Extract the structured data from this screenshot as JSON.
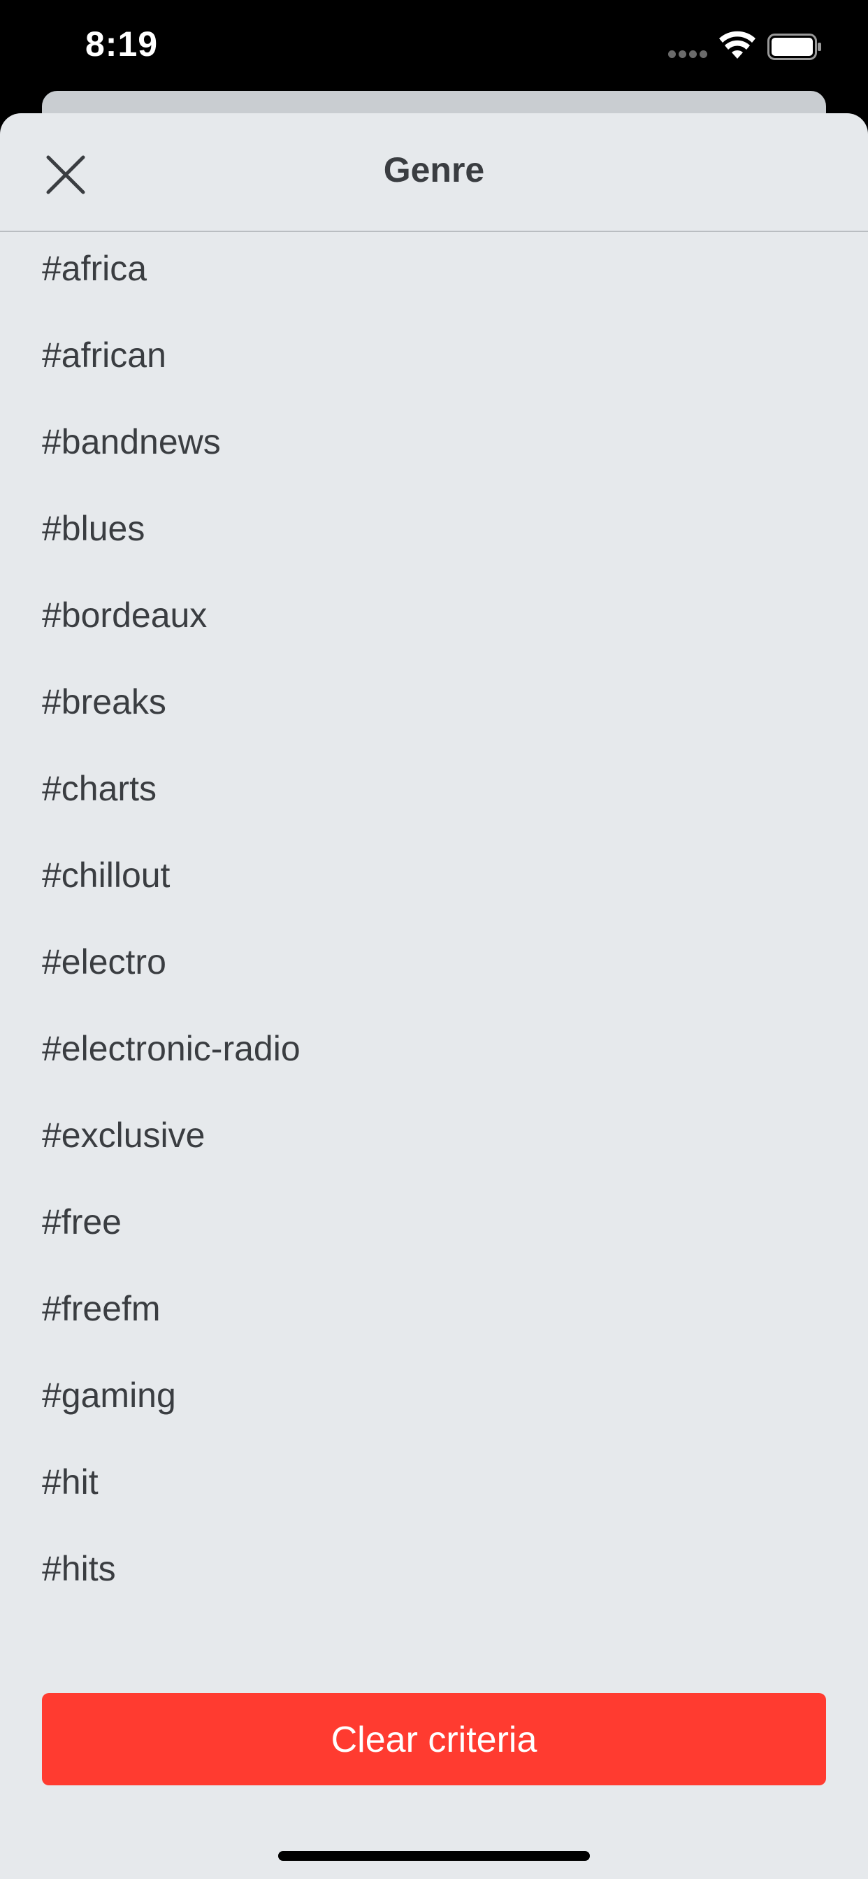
{
  "status_bar": {
    "time": "8:19",
    "icons": [
      "signal-dots-icon",
      "wifi-icon",
      "battery-icon"
    ]
  },
  "sheet": {
    "title": "Genre",
    "close_icon": "close-icon"
  },
  "genres": [
    "#africa",
    "#african",
    "#bandnews",
    "#blues",
    "#bordeaux",
    "#breaks",
    "#charts",
    "#chillout",
    "#electro",
    "#electronic-radio",
    "#exclusive",
    "#free",
    "#freefm",
    "#gaming",
    "#hit",
    "#hits"
  ],
  "footer": {
    "clear_label": "Clear criteria"
  },
  "colors": {
    "accent": "#ff3b30",
    "sheet_bg": "#e6e9ec",
    "text": "#3a3d41"
  }
}
